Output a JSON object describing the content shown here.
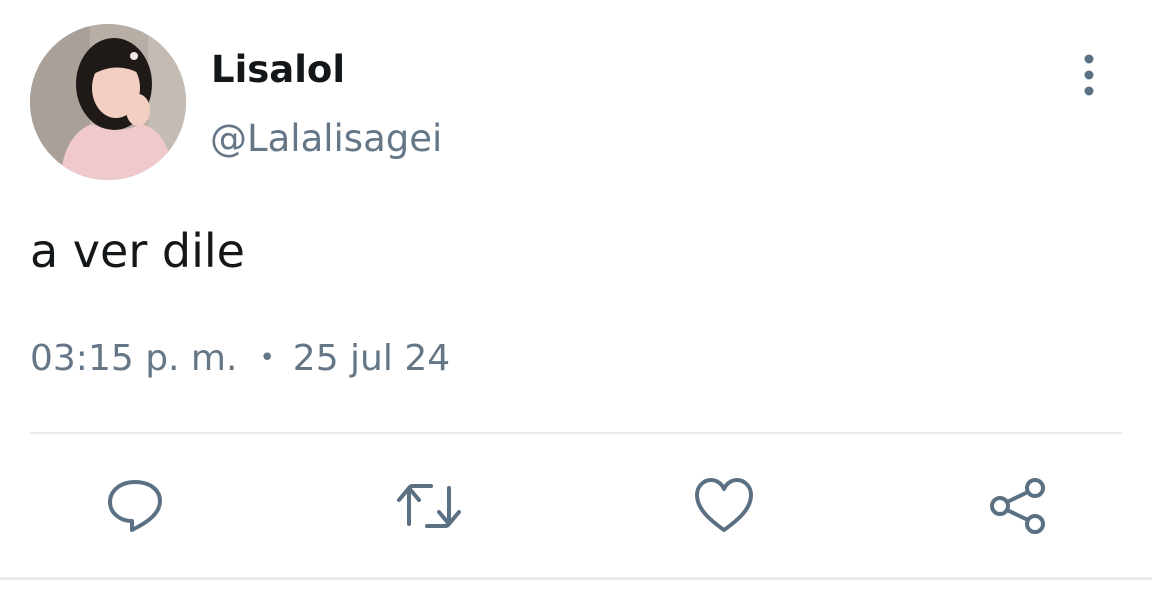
{
  "user": {
    "display_name": "Lisalol",
    "handle": "@Lalalisagei",
    "avatar": "profile-photo"
  },
  "tweet": {
    "text": "a ver dile",
    "time": "03:15 p. m.",
    "separator": "•",
    "date": "25 jul 24"
  },
  "actions": {
    "reply": "reply-icon",
    "retweet": "retweet-icon",
    "like": "heart-icon",
    "share": "share-icon",
    "more": "more-vertical-icon"
  },
  "colors": {
    "text": "#14171a",
    "secondary": "#657786",
    "icon": "#5b7083",
    "divider": "#e6ecf0"
  }
}
